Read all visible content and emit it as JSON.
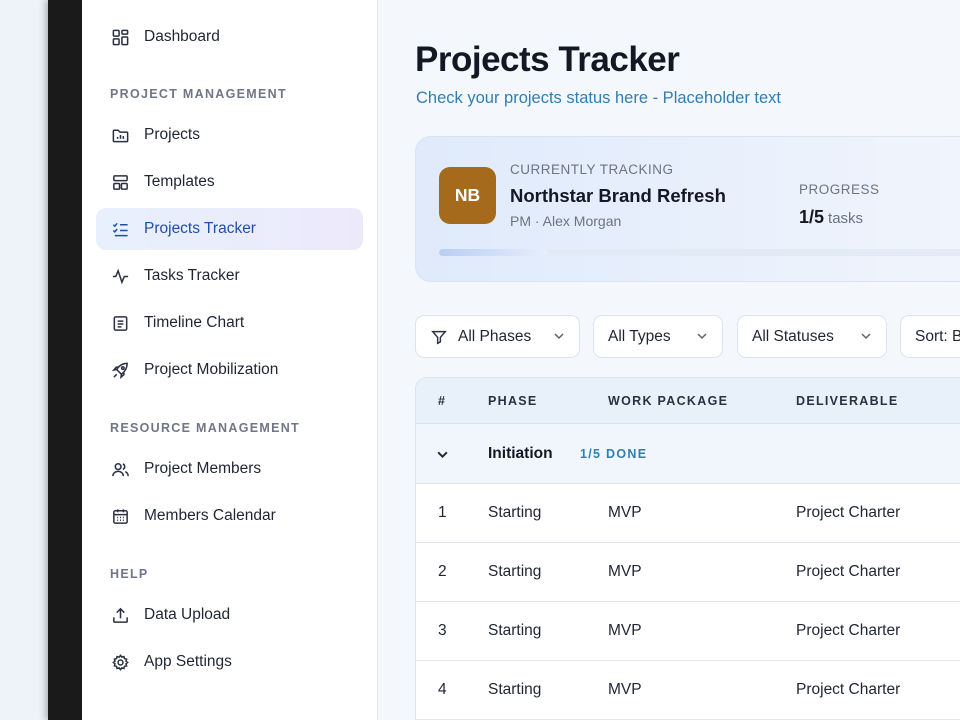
{
  "sidebar": {
    "dashboard": "Dashboard",
    "sections": {
      "project_management": "PROJECT MANAGEMENT",
      "resource_management": "RESOURCE MANAGEMENT",
      "help": "HELP"
    },
    "items": [
      {
        "label": "Projects",
        "icon": "folder-chart-icon"
      },
      {
        "label": "Templates",
        "icon": "layout-icon"
      },
      {
        "label": "Projects Tracker",
        "icon": "checklist-icon",
        "active": true
      },
      {
        "label": "Tasks Tracker",
        "icon": "activity-icon"
      },
      {
        "label": "Timeline Chart",
        "icon": "document-list-icon"
      },
      {
        "label": "Project Mobilization",
        "icon": "rocket-icon"
      },
      {
        "label": "Project Members",
        "icon": "users-icon"
      },
      {
        "label": "Members Calendar",
        "icon": "calendar-icon"
      },
      {
        "label": "Data Upload",
        "icon": "upload-icon"
      },
      {
        "label": "App Settings",
        "icon": "gear-icon"
      }
    ]
  },
  "main": {
    "title": "Projects Tracker",
    "subtitle": "Check your projects status here - Placeholder text"
  },
  "tracking": {
    "label": "CURRENTLY TRACKING",
    "initials": "NB",
    "avatar_color": "#a56a1c",
    "project_name": "Northstar Brand Refresh",
    "pm": "PM · Alex Morgan",
    "progress_label": "PROGRESS",
    "progress_value": "1/5",
    "progress_unit": "tasks",
    "progress_fraction": 0.2
  },
  "filters": {
    "phases": "All Phases",
    "types": "All Types",
    "statuses": "All Statuses",
    "sort": "Sort: B"
  },
  "table": {
    "headers": {
      "num": "#",
      "phase": "PHASE",
      "work_package": "WORK PACKAGE",
      "deliverable": "DELIVERABLE"
    },
    "group": {
      "name": "Initiation",
      "done": "1/5 DONE"
    },
    "rows": [
      {
        "num": "1",
        "phase": "Starting",
        "work_package": "MVP",
        "deliverable": "Project Charter"
      },
      {
        "num": "2",
        "phase": "Starting",
        "work_package": "MVP",
        "deliverable": "Project Charter"
      },
      {
        "num": "3",
        "phase": "Starting",
        "work_package": "MVP",
        "deliverable": "Project Charter"
      },
      {
        "num": "4",
        "phase": "Starting",
        "work_package": "MVP",
        "deliverable": "Project Charter"
      }
    ]
  },
  "colors": {
    "accent": "#2f7fb2",
    "active_nav_text": "#1f4fa8"
  }
}
